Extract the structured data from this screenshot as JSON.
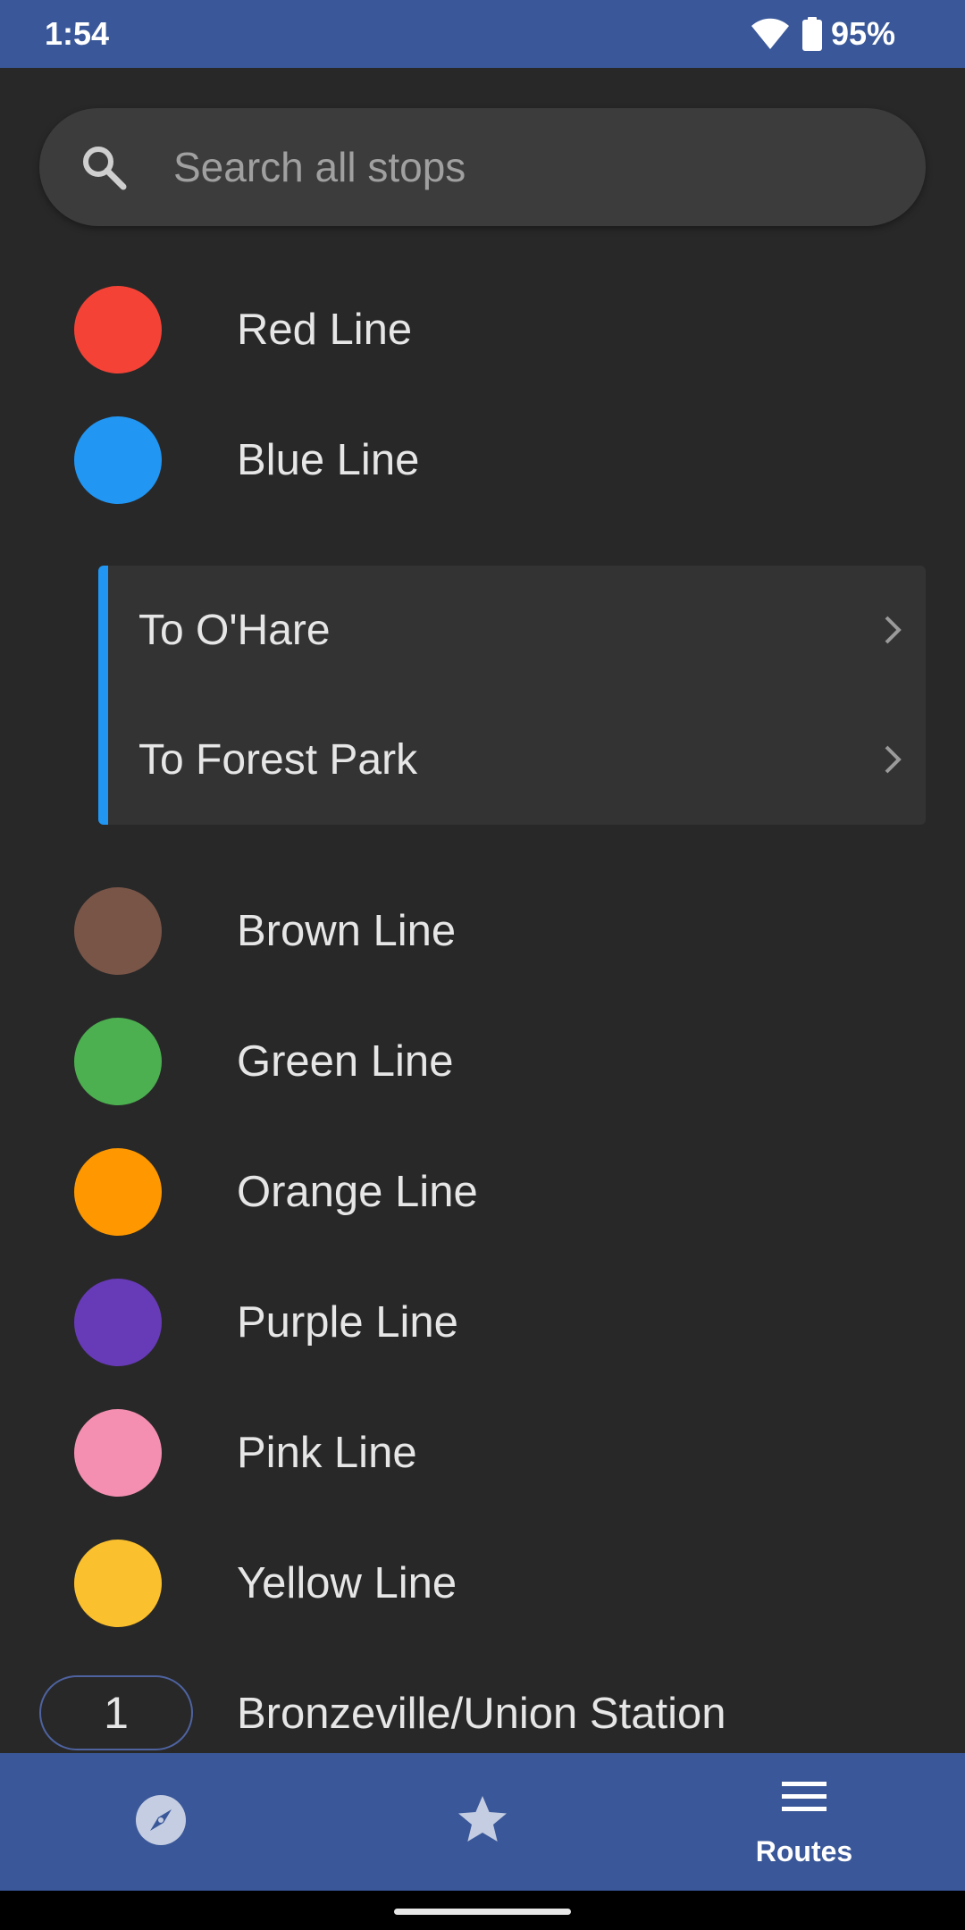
{
  "status_bar": {
    "time": "1:54",
    "battery": "95%",
    "background_color": "#3a5899"
  },
  "search": {
    "placeholder": "Search all stops",
    "value": "",
    "icon": "search-icon"
  },
  "routes": [
    {
      "label": "Red Line",
      "color": "#f44336",
      "badge": "dot"
    },
    {
      "label": "Blue Line",
      "color": "#2196f3",
      "badge": "dot",
      "expanded": true
    },
    {
      "label": "Brown Line",
      "color": "#795548",
      "badge": "dot"
    },
    {
      "label": "Green Line",
      "color": "#4caf50",
      "badge": "dot"
    },
    {
      "label": "Orange Line",
      "color": "#ff9800",
      "badge": "dot"
    },
    {
      "label": "Purple Line",
      "color": "#673ab7",
      "badge": "dot"
    },
    {
      "label": "Pink Line",
      "color": "#f48fb1",
      "badge": "dot"
    },
    {
      "label": "Yellow Line",
      "color": "#fbc02d",
      "badge": "dot"
    },
    {
      "label": "Bronzeville/Union Station",
      "number": "1",
      "badge": "pill",
      "color": "#4e63a0"
    }
  ],
  "blue_line_directions": [
    {
      "label": "To O'Hare",
      "icon": "chevron-right-icon"
    },
    {
      "label": "To Forest Park",
      "icon": "chevron-right-icon"
    }
  ],
  "bottom_nav": {
    "items": [
      {
        "id": "explore",
        "icon": "compass-icon",
        "label": "",
        "active": false
      },
      {
        "id": "favorites",
        "icon": "star-icon",
        "label": "",
        "active": false
      },
      {
        "id": "routes",
        "icon": "menu-icon",
        "label": "Routes",
        "active": true
      }
    ],
    "background_color": "#3a5899"
  }
}
